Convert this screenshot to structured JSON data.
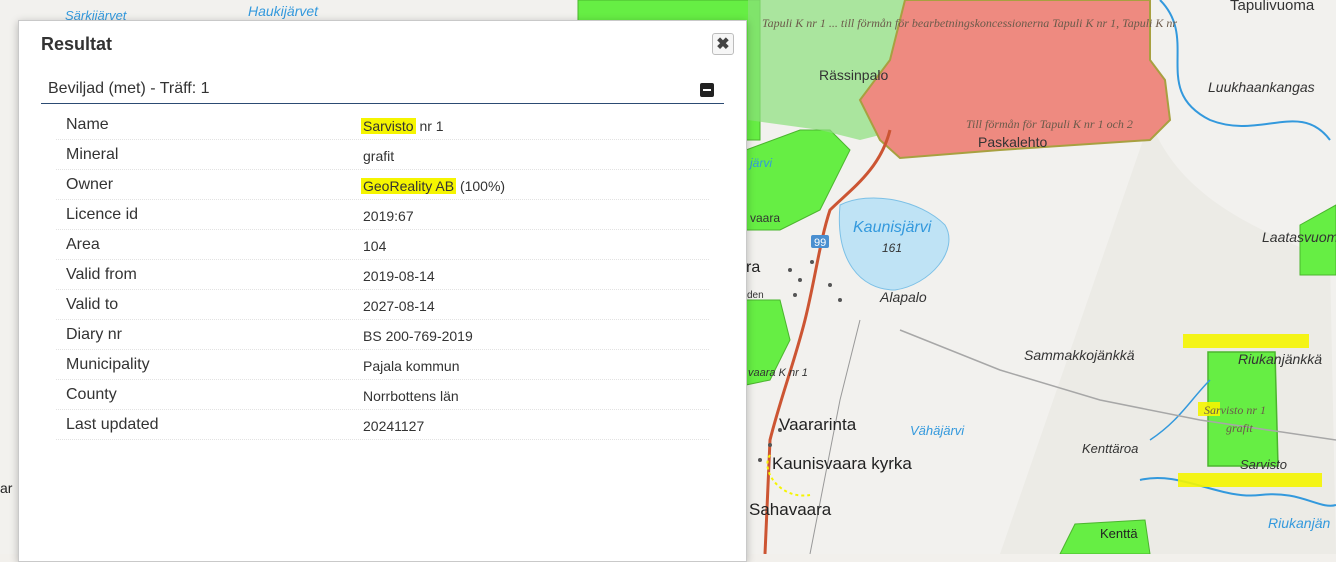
{
  "dialog": {
    "title": "Resultat",
    "close_icon": "✖",
    "section_title": "Beviljad (met) - Träff: 1"
  },
  "rows": [
    {
      "label": "Name",
      "value_hl": "Sarvisto",
      "value": " nr 1"
    },
    {
      "label": "Mineral",
      "value_hl": "",
      "value": "grafit"
    },
    {
      "label": "Owner",
      "value_hl": "GeoReality AB",
      "value": " (100%)"
    },
    {
      "label": "Licence id",
      "value_hl": "",
      "value": "2019:67"
    },
    {
      "label": "Area",
      "value_hl": "",
      "value": "104"
    },
    {
      "label": "Valid from",
      "value_hl": "",
      "value": "2019-08-14"
    },
    {
      "label": "Valid to",
      "value_hl": "",
      "value": "2027-08-14"
    },
    {
      "label": "Diary nr",
      "value_hl": "",
      "value": "BS 200-769-2019"
    },
    {
      "label": "Municipality",
      "value_hl": "",
      "value": "Pajala kommun"
    },
    {
      "label": "County",
      "value_hl": "",
      "value": "Norrbottens län"
    },
    {
      "label": "Last updated",
      "value_hl": "",
      "value": "20241127"
    }
  ],
  "map": {
    "labels": {
      "sarkijarvet": "Särkijärvet",
      "haukijarvet": "Haukijärvet",
      "tapulivuoma": "Tapulivuoma",
      "concession_text": "Tapuli K nr 1 ... till förmån för bearbetningskoncessionerna Tapuli K nr 1, Tapuli K nr",
      "rassinpalo": "Rässinpalo",
      "luukhaankangas": "Luukhaankangas",
      "till_forman": "Till förmån för Tapuli K nr 1 och 2",
      "paskalehto": "Paskalehto",
      "jarvi": "järvi",
      "vaara": "vaara",
      "kaunisjarvi": "Kaunisjärvi",
      "elev_161": "161",
      "laatasvuoma": "Laatasvuom",
      "road_99": "99",
      "ra": "ra",
      "den": "den",
      "alapalo": "Alapalo",
      "sammakkojankka": "Sammakkojänkkä",
      "riukanjankka": "Riukanjänkkä",
      "vaara_k_nr1": "vaara K nr 1",
      "sarvisto_nr1": "Sarvisto nr 1",
      "grafit": "grafit",
      "vaararinta": "Vaararinta",
      "vahajarvi": "Vähäjärvi",
      "kenttaroa": "Kenttäroa",
      "kaunisvaara_kyrka": "Kaunisvaara kyrka",
      "sarvisto": "Sarvisto",
      "ar": "ar",
      "sahavaara": "Sahavaara",
      "kentta": "Kenttä",
      "riukanjan": "Riukanjän"
    }
  },
  "colors": {
    "green_area": "#66ee44",
    "red_area": "#ee8a80",
    "water": "#3399dd",
    "road": "#cc5533",
    "highlight": "#f5f500"
  }
}
